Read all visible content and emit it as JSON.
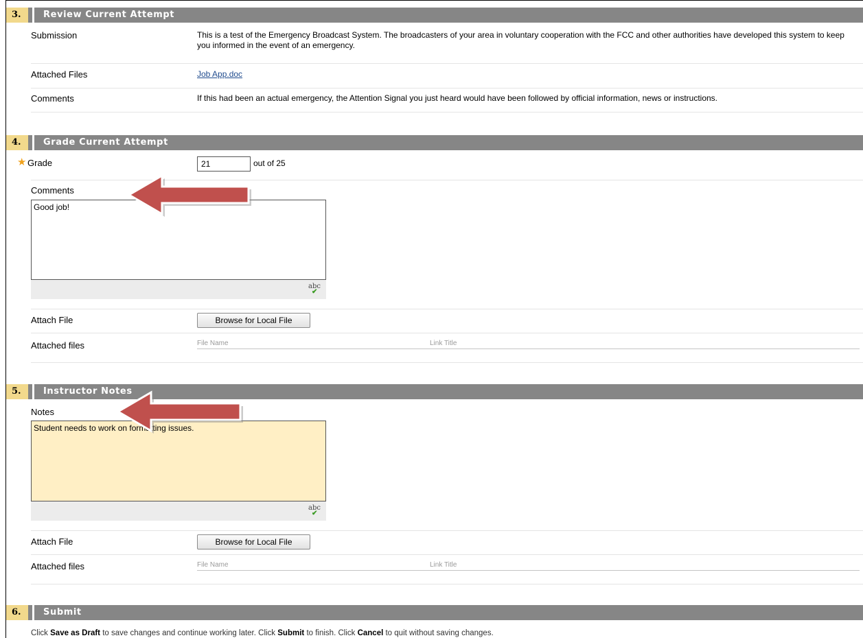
{
  "sections": {
    "review": {
      "num": "3.",
      "title": "Review Current Attempt",
      "submission_label": "Submission",
      "submission_text": "This is a test of the Emergency Broadcast System. The broadcasters of your area in voluntary cooperation with the FCC and other authorities have developed this system to keep you informed in the event of an emergency.",
      "attached_files_label": "Attached Files",
      "attached_file_link": "Job App.doc",
      "comments_label": "Comments",
      "comments_text": "If this had been an actual emergency, the Attention Signal you just heard would have been followed by official information, news or instructions."
    },
    "grade": {
      "num": "4.",
      "title": "Grade Current Attempt",
      "grade_label": "Grade",
      "grade_value": "21",
      "out_of": "out of 25",
      "comments_label": "Comments",
      "comments_value": "Good job!",
      "attach_file_label": "Attach File",
      "browse_label": "Browse for Local File",
      "attached_files_label": "Attached files",
      "col_file_name": "File Name",
      "col_link_title": "Link Title"
    },
    "notes": {
      "num": "5.",
      "title": "Instructor Notes",
      "notes_label": "Notes",
      "notes_value": "Student needs to work on formatting issues.",
      "attach_file_label": "Attach File",
      "browse_label": "Browse for Local File",
      "attached_files_label": "Attached files",
      "col_file_name": "File Name",
      "col_link_title": "Link Title"
    },
    "submit": {
      "num": "6.",
      "title": "Submit",
      "instr_1": "Click ",
      "save_draft": "Save as Draft",
      "instr_2": " to save changes and continue working later. Click ",
      "submit_word": "Submit",
      "instr_3": " to finish. Click ",
      "cancel_word": "Cancel",
      "instr_4": " to quit without saving changes."
    }
  },
  "icons": {
    "required": "required-star-icon",
    "spellcheck": "spellcheck-icon",
    "annotation_arrow": "annotation-arrow-icon"
  },
  "colors": {
    "header_bg": "#868686",
    "number_bg": "#f2d98c",
    "notes_bg": "#ffefc5",
    "arrow_fill": "#c0504d",
    "required_star": "#f0a21d",
    "link": "#1f4b8e"
  }
}
